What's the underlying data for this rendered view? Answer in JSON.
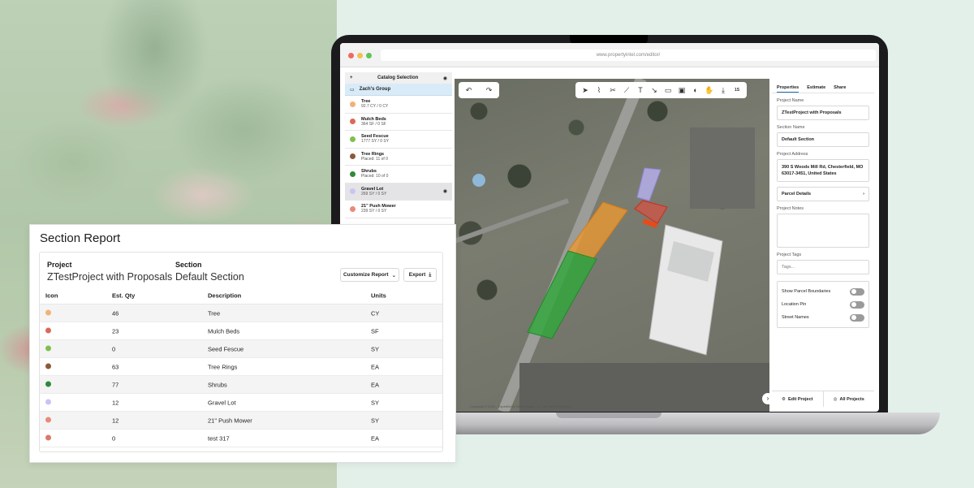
{
  "browser": {
    "url": "www.propertyintel.com/editor/"
  },
  "catalog": {
    "title": "Catalog Selection",
    "group": "Zach's Group",
    "items": [
      {
        "name": "Tree",
        "detail": "92.7 CY / 0 CY",
        "color": "#f0b277"
      },
      {
        "name": "Mulch Beds",
        "detail": "364 SF / 0 SF",
        "color": "#d96a58"
      },
      {
        "name": "Seed Fescue",
        "detail": "1777 SY / 0 SY",
        "color": "#7fbf4f"
      },
      {
        "name": "Tree Rings",
        "detail": "Placed: 11 of 0",
        "color": "#8a5a3c"
      },
      {
        "name": "Shrubs",
        "detail": "Placed: 10 of 0",
        "color": "#2f8a3a"
      },
      {
        "name": "Gravel Lot",
        "detail": "269 SY / 0 SY",
        "color": "#c9c5f0"
      },
      {
        "name": "21\" Push Mower",
        "detail": "239 SY / 0 SY",
        "color": "#e88a7a"
      }
    ]
  },
  "map": {
    "next": "›",
    "copyright": "Copyright © 2023 - ExpertDrive Technologies, Inc. All Rights Reserved",
    "tool_badge": "1S"
  },
  "properties": {
    "tabs": [
      "Properties",
      "Estimate",
      "Share"
    ],
    "project_name_label": "Project Name",
    "project_name": "ZTestProject with Proposals",
    "section_name_label": "Section Name",
    "section_name": "Default Section",
    "address_label": "Project Address",
    "address": "390 S Woods Mill Rd, Chesterfield, MO 63017-3451, United States",
    "parcel_details": "Parcel Details",
    "notes_label": "Project Notes",
    "tags_label": "Project Tags",
    "tags_placeholder": "Tags...",
    "toggles": [
      "Show Parcel Boundaries",
      "Location Pin",
      "Street Names"
    ],
    "edit_project": "Edit Project",
    "all_projects": "All Projects"
  },
  "report": {
    "title": "Section Report",
    "project_label": "Project",
    "project_value": "ZTestProject with Proposals",
    "section_label": "Section",
    "section_value": "Default Section",
    "customize_label": "Customize Report",
    "export_label": "Export",
    "columns": [
      "Icon",
      "Est. Qty",
      "Description",
      "Units"
    ],
    "rows": [
      {
        "qty": "46",
        "description": "Tree",
        "units": "CY",
        "color": "#f0b277"
      },
      {
        "qty": "23",
        "description": "Mulch Beds",
        "units": "SF",
        "color": "#d96a58"
      },
      {
        "qty": "0",
        "description": "Seed Fescue",
        "units": "SY",
        "color": "#7fbf4f"
      },
      {
        "qty": "63",
        "description": "Tree Rings",
        "units": "EA",
        "color": "#8a5a3c"
      },
      {
        "qty": "77",
        "description": "Shrubs",
        "units": "EA",
        "color": "#2f8a3a"
      },
      {
        "qty": "12",
        "description": "Gravel Lot",
        "units": "SY",
        "color": "#c9c5f0"
      },
      {
        "qty": "12",
        "description": "21\" Push Mower",
        "units": "SY",
        "color": "#e88a7a"
      },
      {
        "qty": "0",
        "description": "test 317",
        "units": "EA",
        "color": "#d97a6a"
      }
    ]
  }
}
